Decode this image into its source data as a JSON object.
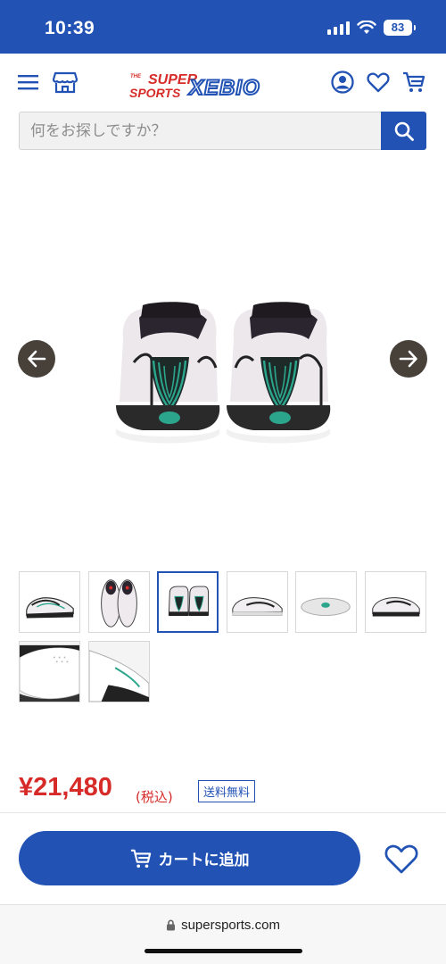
{
  "status_bar": {
    "time": "10:39",
    "battery": "83"
  },
  "header": {
    "logo_line1_small": "THE",
    "logo_line1": "SUPER",
    "logo_line2": "SPORTS",
    "logo_brand": "XEBIO",
    "icons": [
      "menu-icon",
      "store-icon",
      "account-icon",
      "heart-icon",
      "cart-icon"
    ]
  },
  "search": {
    "placeholder": "何をお探しですか？"
  },
  "gallery": {
    "thumbnail_count": 8,
    "active_index": 2
  },
  "product": {
    "price": "¥21,480",
    "tax": "(税込)",
    "shipping_badge": "送料無料"
  },
  "actions": {
    "add_to_cart": "カートに追加"
  },
  "browser": {
    "url": "supersports.com"
  },
  "colors": {
    "brand_blue": "#2152b4",
    "price_red": "#d62b28",
    "arrow_bg": "#47413a",
    "accent_teal": "#2ca58d"
  }
}
